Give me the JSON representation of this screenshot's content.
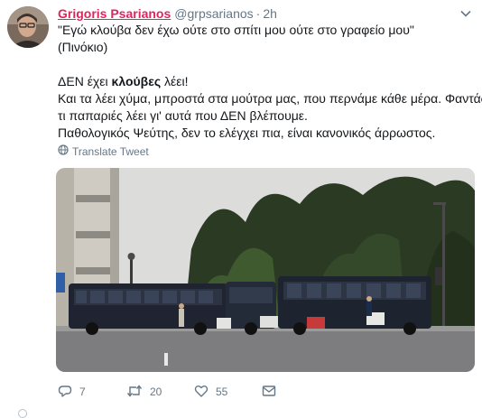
{
  "tweet": {
    "author": {
      "display_name": "Grigoris Psarianos",
      "handle": "@grpsarianos",
      "avatar_icon": "avatar-photo"
    },
    "separator": "·",
    "timestamp": "2h",
    "caret_icon": "chevron-down-icon",
    "body_lines": {
      "l1": "\"Εγώ κλούβα δεν έχω ούτε στο σπίτι μου ούτε στο γραφείο μου\"",
      "l2": "(Πινόκιο)",
      "l3_a": "ΔΕΝ έχει ",
      "l3_bold": "κλούβες",
      "l3_b": " λέει!",
      "l4": "Και τα λέει χύμα, μπροστά στα μούτρα μας, που περνάμε κάθε μέρα. Φαντάσου",
      "l5": "τι παπαριές λέει γι' αυτά που ΔΕΝ βλέπουμε.",
      "l6": "Παθολογικός Ψεύτης, δεν το ελέγχει πια, είναι κανονικός  άρρωστος."
    },
    "translate_label": "Translate Tweet",
    "translate_icon": "globe-icon",
    "actions": {
      "reply": {
        "icon": "reply-icon",
        "count": "7"
      },
      "retweet": {
        "icon": "retweet-icon",
        "count": "20"
      },
      "like": {
        "icon": "heart-icon",
        "count": "55"
      },
      "message": {
        "icon": "envelope-icon"
      }
    },
    "colors": {
      "name": "#e0245e",
      "secondary_text": "#657786",
      "body_text": "#14171a"
    }
  }
}
